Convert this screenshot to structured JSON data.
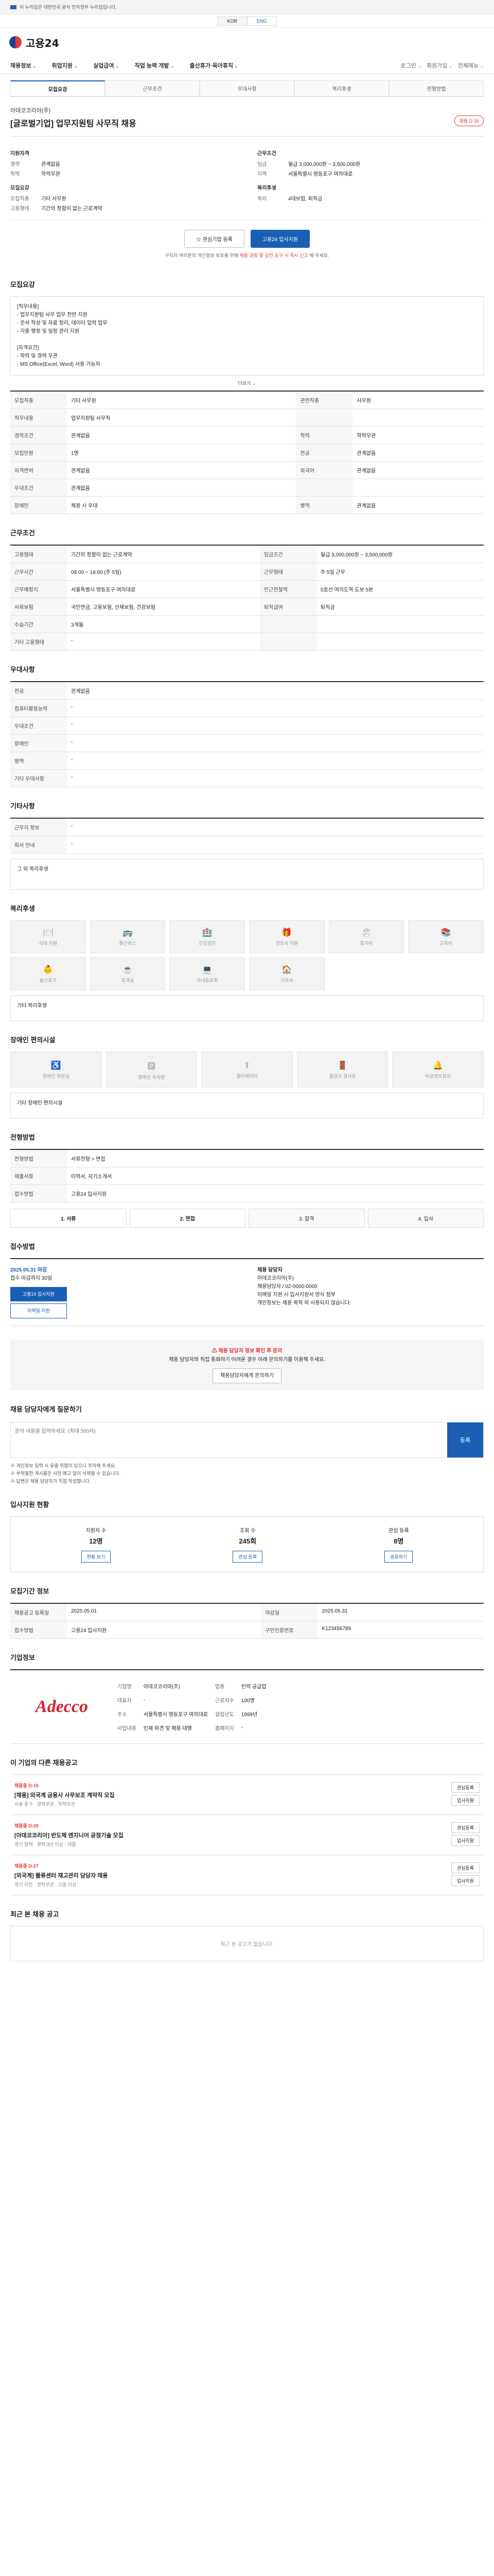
{
  "banner": {
    "notice": "이 누리집은 대한민국 공식 전자정부 누리집입니다."
  },
  "langs": [
    "KOR",
    "ENG"
  ],
  "brand": {
    "name": "고용24"
  },
  "gnb": {
    "items": [
      "채용정보",
      "취업지원",
      "실업급여",
      "직업 능력 개발",
      "출산휴가·육아휴직"
    ],
    "util": [
      "로그인",
      "회원가입",
      "전체메뉴"
    ]
  },
  "subtabs": [
    "모집요강",
    "근무조건",
    "우대사항",
    "복리후생",
    "전형방법"
  ],
  "job": {
    "company": "아데코코리아(주)",
    "title": "[글로벌기업] 업무지원팀 사무직 채용",
    "status": "채용 D-30"
  },
  "summary": {
    "left": {
      "heading": "지원자격",
      "rows": [
        [
          "경력",
          "관계없음"
        ],
        [
          "학력",
          "학력무관"
        ]
      ],
      "heading2": "모집요강",
      "rows2": [
        [
          "모집직종",
          "기타 사무원"
        ],
        [
          "고용형태",
          "기간의 정함이 없는 근로계약"
        ]
      ]
    },
    "right": {
      "heading": "근무조건",
      "rows": [
        [
          "임금",
          "월급 3,000,000원 ~ 3,500,000원"
        ],
        [
          "지역",
          "서울특별시 영등포구 여의대로"
        ]
      ],
      "heading2": "복리후생",
      "rows2": [
        [
          "복리",
          "4대보험, 퇴직금"
        ]
      ]
    }
  },
  "actions": {
    "fav": "관심기업 등록",
    "apply": "고용24 입사지원"
  },
  "note": {
    "text": "구직자 여러분의 개인정보 보호를 위해 ",
    "red": "채용 과정 중 금전 요구 시 즉시 신고",
    "tail": " 해 주세요."
  },
  "recruit": {
    "title": "모집요강",
    "body": "[직무내용]\n- 업무지원팀 사무 업무 전반 지원\n- 문서 작성 및 자료 정리, 데이터 입력 업무\n- 각종 행정 및 일정 관리 지원\n\n[자격요건]\n- 학력 및 경력 무관\n- MS Office(Excel, Word) 사용 가능자",
    "more": "더보기",
    "rows": [
      [
        "모집직종",
        "기타 사무원",
        "관련직종",
        "사무원"
      ],
      [
        "직무내용",
        "업무지원팀 사무직",
        "",
        ""
      ],
      [
        "경력조건",
        "관계없음",
        "학력",
        "학력무관"
      ],
      [
        "모집인원",
        "1명",
        "전공",
        "관계없음"
      ],
      [
        "자격면허",
        "관계없음",
        "외국어",
        "관계없음"
      ],
      [
        "우대조건",
        "관계없음",
        "",
        ""
      ],
      [
        "장애인",
        "채용 시 우대",
        "병역",
        "관계없음"
      ]
    ]
  },
  "work": {
    "title": "근무조건",
    "rows": [
      [
        "고용형태",
        "기간의 정함이 없는 근로계약",
        "임금조건",
        "월급 3,000,000원 ~ 3,500,000원"
      ],
      [
        "근무시간",
        "09:00 ~ 18:00 (주 5일)",
        "근무형태",
        "주 5일 근무"
      ],
      [
        "근무예정지",
        "서울특별시 영등포구 여의대로",
        "인근전철역",
        "5호선 여의도역 도보 5분"
      ],
      [
        "사회보험",
        "국민연금, 고용보험, 산재보험, 건강보험",
        "퇴직급여",
        "퇴직금"
      ],
      [
        "수습기간",
        "3개월",
        "",
        ""
      ],
      [
        "기타 고용형태",
        "-",
        "",
        ""
      ]
    ]
  },
  "prefer": {
    "title": "우대사항",
    "rows": [
      [
        "전공",
        "관계없음"
      ],
      [
        "컴퓨터활용능력",
        "-"
      ],
      [
        "우대조건",
        "-"
      ],
      [
        "장애인",
        "-"
      ],
      [
        "병역",
        "-"
      ],
      [
        "기타 우대사항",
        "-"
      ]
    ]
  },
  "contact": {
    "title": "기타사항",
    "rows": [
      [
        "근무지 정보",
        "-"
      ],
      [
        "회사 안내",
        "-"
      ]
    ],
    "extra": "그 외 복리후생"
  },
  "welfare": {
    "title": "복리후생",
    "items": [
      [
        "🍽",
        "식대 지원"
      ],
      [
        "🚌",
        "통근버스"
      ],
      [
        "🏥",
        "건강검진"
      ],
      [
        "🎁",
        "경조사 지원"
      ],
      [
        "🏖",
        "휴가비"
      ],
      [
        "📚",
        "교육비"
      ],
      [
        "👶",
        "출산휴가"
      ],
      [
        "☕",
        "휴게실"
      ],
      [
        "💻",
        "사내동호회"
      ],
      [
        "🏠",
        "기숙사"
      ]
    ],
    "extra": "기타 복리후생"
  },
  "facility": {
    "title": "장애인 편의시설",
    "items": [
      [
        "♿",
        "장애인 화장실"
      ],
      [
        "🅿",
        "장애인 주차장"
      ],
      [
        "⬆",
        "엘리베이터"
      ],
      [
        "🚪",
        "출입구 경사로"
      ],
      [
        "🔔",
        "비상경보장치"
      ]
    ],
    "extra": "기타 장애인 편의시설"
  },
  "selection": {
    "title": "전형방법",
    "rows": [
      [
        "전형방법",
        "서류전형 > 면접"
      ],
      [
        "제출서류",
        "이력서, 자기소개서"
      ],
      [
        "접수방법",
        "고용24 입사지원"
      ]
    ],
    "steps": [
      "1. 서류",
      "2. 면접",
      "3. 합격",
      "4. 입사"
    ]
  },
  "apply": {
    "title": "접수방법",
    "deadline": "2025.05.31 마감",
    "remain": "접수 마감까지 30일",
    "btn1": "고용24 입사지원",
    "btn2": "이메일 지원",
    "right_title": "채용 담당자",
    "right": "아데코코리아(주)\n채용담당자 / 02-0000-0000\n이메일 지원 시 입사지원서 양식 첨부\n개인정보는 채용 목적 외 사용되지 않습니다."
  },
  "warning": {
    "title": "채용 담당자 정보 확인 후 문의",
    "text": "채용 담당자와 직접 통화하기 어려운 경우 아래 문의하기를 이용해 주세요.",
    "btn": "채용담당자에게 문의하기"
  },
  "inquiry": {
    "title": "채용 담당자에게 질문하기",
    "placeholder": "문의 내용을 입력하세요. (최대 500자)",
    "submit": "등록",
    "bullets": [
      "※ 개인정보 입력 시 유출 위험이 있으니 주의해 주세요.",
      "※ 부적절한 게시물은 사전 예고 없이 삭제될 수 있습니다.",
      "※ 답변은 채용 담당자가 직접 작성합니다."
    ]
  },
  "alarm": {
    "title": "입사지원 현황",
    "items": [
      [
        "지원자 수",
        "12명",
        "현황 보기"
      ],
      [
        "조회 수",
        "245회",
        "관심 등록"
      ],
      [
        "관심 등록",
        "8명",
        "공유하기"
      ]
    ]
  },
  "period": {
    "title": "모집기간 정보",
    "rows": [
      [
        "채용공고 등록일",
        "2025.05.01",
        "마감일",
        "2025.05.31"
      ],
      [
        "접수방법",
        "고용24 입사지원",
        "구인인증번호",
        "K123456789"
      ]
    ]
  },
  "company": {
    "title": "기업정보",
    "logo": "Adecco",
    "rows": [
      [
        "기업명",
        "아데코코리아(주)",
        "업종",
        "인력 공급업"
      ],
      [
        "대표자",
        "-",
        "근로자수",
        "100명"
      ],
      [
        "주소",
        "서울특별시 영등포구 여의대로",
        "설립년도",
        "1999년"
      ],
      [
        "사업내용",
        "인재 파견 및 채용 대행",
        "홈페이지",
        "-"
      ]
    ]
  },
  "joblist": {
    "title": "이 기업의 다른 채용공고",
    "items": [
      {
        "badge": "채용중 D-15",
        "title": "[채용] 외국계 금융사 사무보조 계약직 모집",
        "meta": "서울 중구 · 경력무관 · 학력무관"
      },
      {
        "badge": "채용중 D-20",
        "title": "[아데코코리아] 반도체 엔지니어 공정기술 모집",
        "meta": "경기 평택 · 경력 3년 이상 · 대졸"
      },
      {
        "badge": "채용중 D-27",
        "title": "[외국계] 물류센터 재고관리 담당자 채용",
        "meta": "경기 이천 · 경력무관 · 고졸 이상"
      }
    ],
    "btns": [
      "관심등록",
      "입사지원"
    ]
  },
  "recent": {
    "title": "최근 본 채용 공고",
    "empty": "최근 본 공고가 없습니다."
  }
}
